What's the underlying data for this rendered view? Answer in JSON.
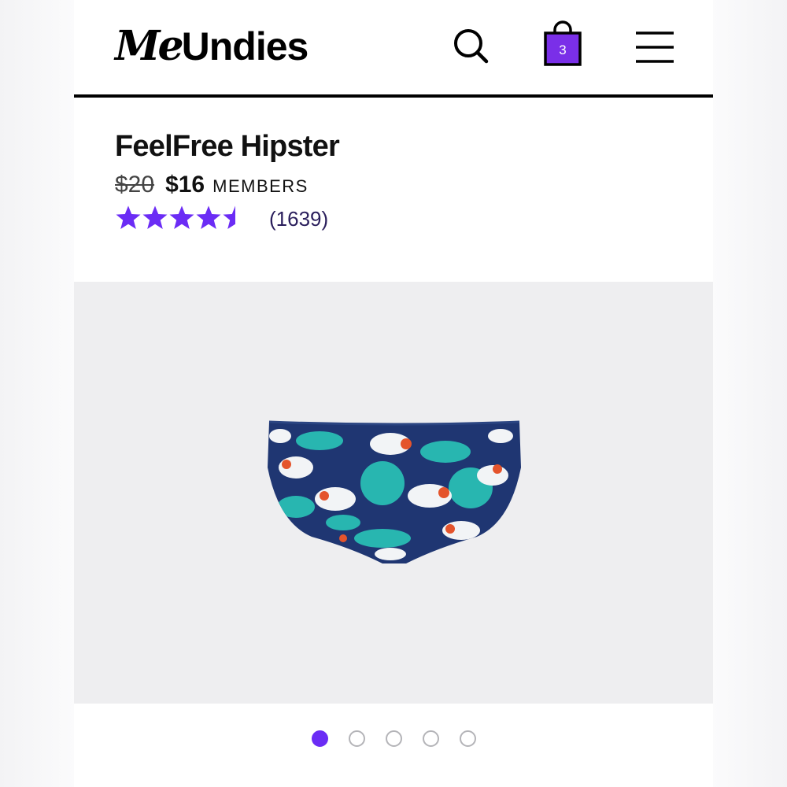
{
  "header": {
    "logo_me": "Me",
    "logo_undies": "Undies",
    "search_icon": "search-icon",
    "bag_icon": "shopping-bag-icon",
    "bag_count": "3",
    "menu_icon": "hamburger-menu-icon"
  },
  "product": {
    "title": "FeelFree Hipster",
    "price_original": "$20",
    "price_member": "$16",
    "price_member_label": "MEMBERS",
    "rating": 4.5,
    "rating_max": 5,
    "review_count": "(1639)"
  },
  "gallery": {
    "image_icon": "product-photo-hipster",
    "slide_count": 5,
    "active_slide": 1
  },
  "colors": {
    "accent": "#6b2cf5",
    "text": "#111111",
    "gallery_bg": "#eeeef0",
    "review_text": "#2a1e5c"
  }
}
